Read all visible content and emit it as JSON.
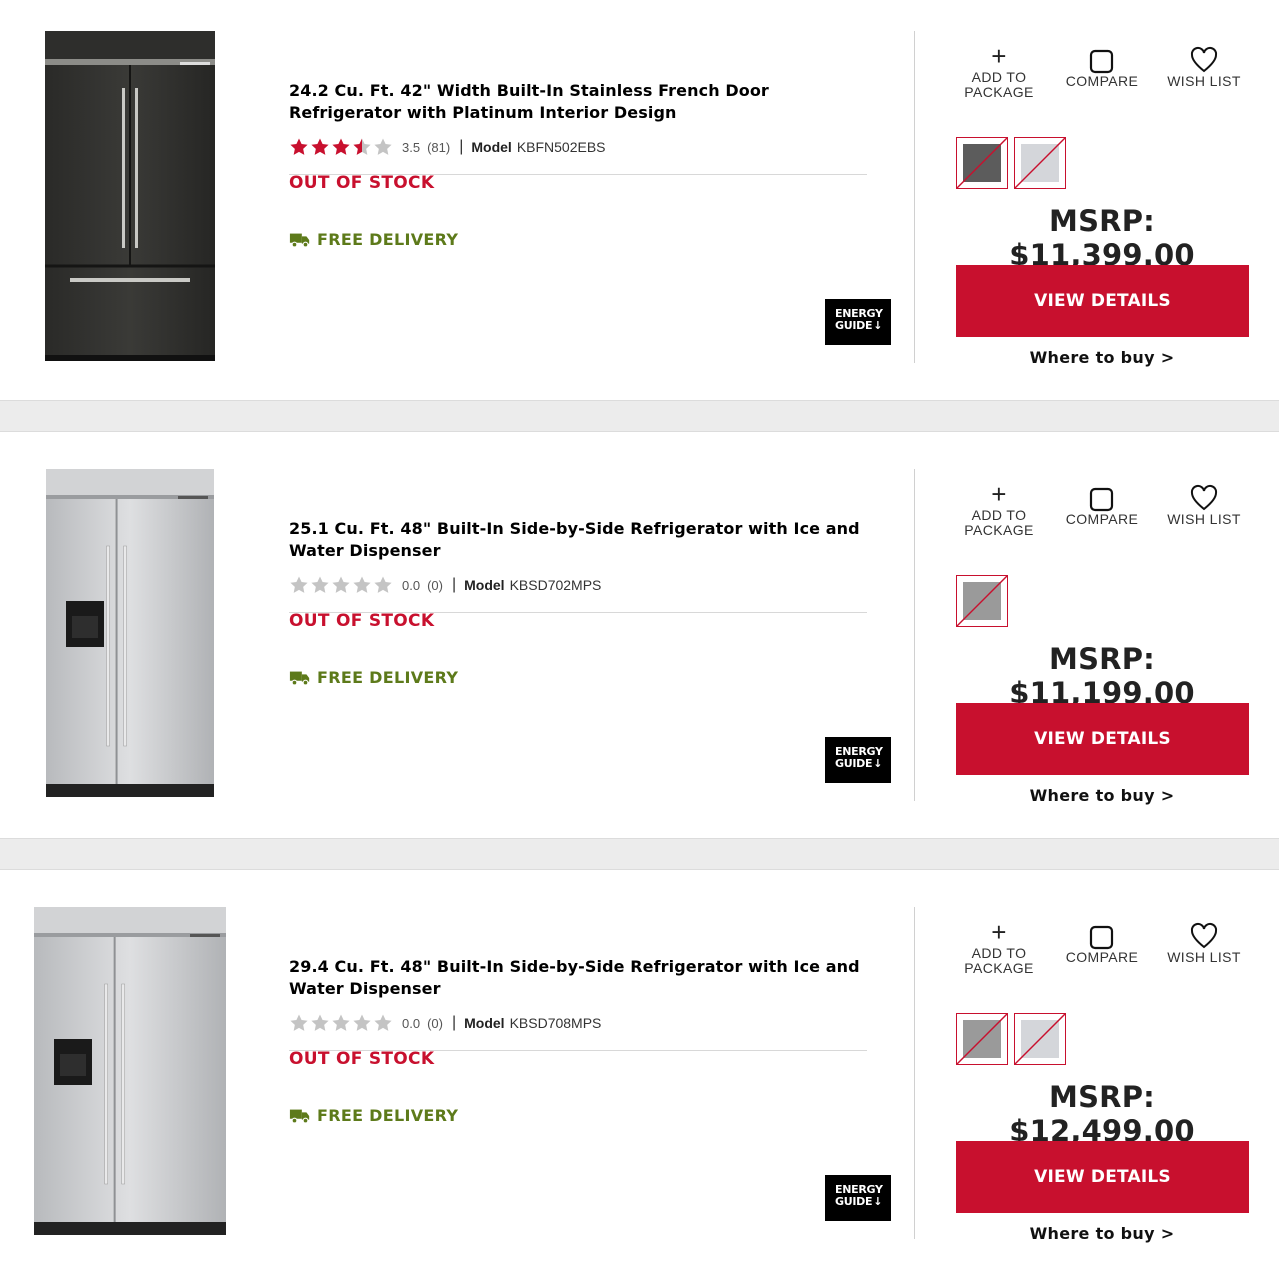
{
  "products": [
    {
      "title": "24.2 Cu. Ft. 42\" Width Built-In Stainless French Door Refrigerator with Platinum Interior Design",
      "rating": 3.5,
      "rating_text": "3.5",
      "review_count": "(81)",
      "model_label": "Model",
      "model": "KBFN502EBS",
      "stock_status": "OUT OF STOCK",
      "delivery": "FREE DELIVERY",
      "energy_guide": "ENERGY GUIDE",
      "price": "MSRP: $11,399.00",
      "swatch_colors": [
        "#5c5c5c",
        "#d4d6da"
      ],
      "fridge_style": "french-black"
    },
    {
      "title": "25.1 Cu. Ft. 48\" Built-In Side-by-Side Refrigerator with Ice and Water Dispenser",
      "rating": 0,
      "rating_text": "0.0",
      "review_count": "(0)",
      "model_label": "Model",
      "model": "KBSD702MPS",
      "stock_status": "OUT OF STOCK",
      "delivery": "FREE DELIVERY",
      "energy_guide": "ENERGY GUIDE",
      "price": "MSRP: $11,199.00",
      "swatch_colors": [
        "#9a9a9a"
      ],
      "fridge_style": "sxs-steel"
    },
    {
      "title": "29.4 Cu. Ft. 48\" Built-In Side-by-Side Refrigerator with Ice and Water Dispenser",
      "rating": 0,
      "rating_text": "0.0",
      "review_count": "(0)",
      "model_label": "Model",
      "model": "KBSD708MPS",
      "stock_status": "OUT OF STOCK",
      "delivery": "FREE DELIVERY",
      "energy_guide": "ENERGY GUIDE",
      "price": "MSRP: $12,499.00",
      "swatch_colors": [
        "#9a9a9a",
        "#d4d6da"
      ],
      "fridge_style": "sxs-steel-wide"
    }
  ],
  "actions": {
    "add_to_package": "ADD TO PACKAGE",
    "compare": "COMPARE",
    "wish_list": "WISH LIST"
  },
  "buttons": {
    "view_details": "VIEW DETAILS",
    "where_to_buy": "Where to buy >"
  },
  "colors": {
    "brand_red": "#c8102e",
    "delivery_green": "#5d7a1a",
    "star_red": "#c8102e",
    "star_empty": "#c4c4c4"
  },
  "icons": {
    "add": "plus-icon",
    "compare": "checkbox-icon",
    "wish": "heart-icon",
    "delivery": "truck-icon",
    "star": "star-icon"
  }
}
